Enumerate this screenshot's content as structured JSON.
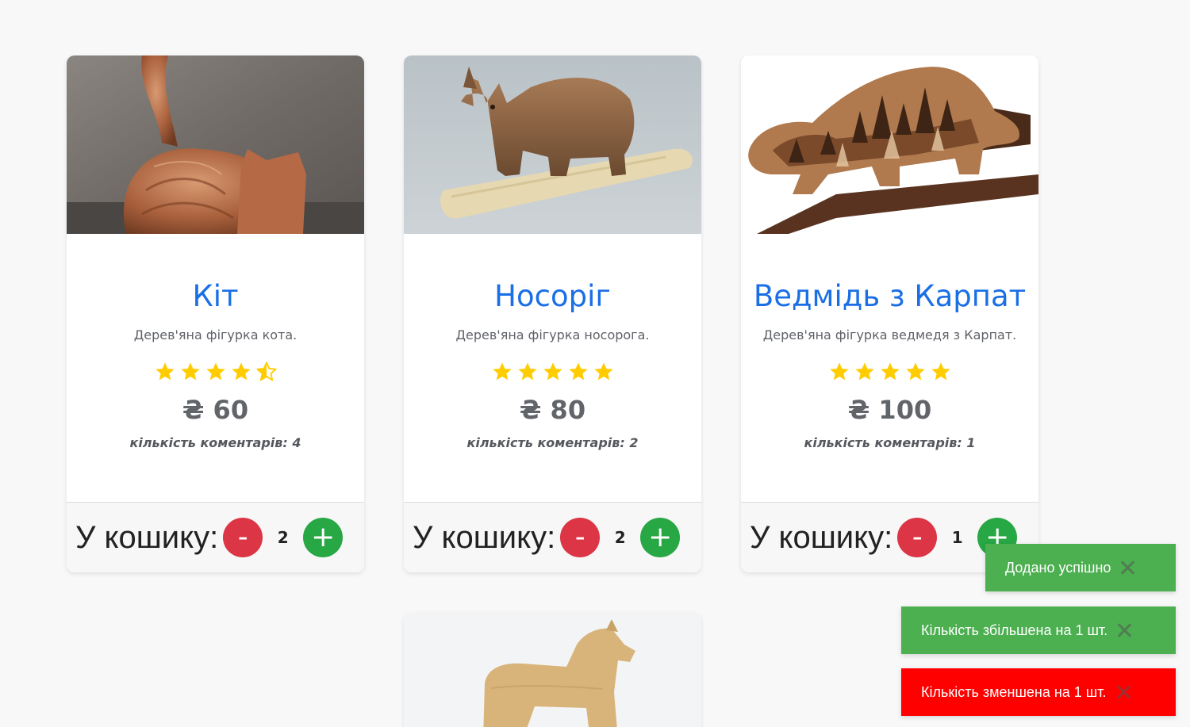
{
  "products": [
    {
      "title": "Кіт",
      "description": "Дерев'яна фігурка кота.",
      "rating": 4.5,
      "price": "₴ 60",
      "comments": "кількість коментарів: 4",
      "cart_label": "У кошику:",
      "minus_label": "-",
      "plus_label": "+",
      "quantity": "2",
      "image": "wooden-cat-figurine"
    },
    {
      "title": "Носоріг",
      "description": "Дерев'яна фігурка носорога.",
      "rating": 5,
      "price": "₴ 80",
      "comments": "кількість коментарів: 2",
      "cart_label": "У кошику:",
      "minus_label": "-",
      "plus_label": "+",
      "quantity": "2",
      "image": "wooden-rhino-figurine"
    },
    {
      "title": "Ведмідь з Карпат",
      "description": "Дерев'яна фігурка ведмедя з Карпат.",
      "rating": 5,
      "price": "₴ 100",
      "comments": "кількість коментарів: 1",
      "cart_label": "У кошику:",
      "minus_label": "-",
      "plus_label": "+",
      "quantity": "1",
      "image": "carpathian-bear-figurine"
    },
    {
      "image": "wooden-horse-figurine"
    }
  ],
  "toasts": [
    {
      "text": "Додано успішно",
      "color": "#4caf50"
    },
    {
      "text": "Кількість збільшена на 1 шт.",
      "color": "#4caf50"
    },
    {
      "text": "Кількість зменшена на 1 шт.",
      "color": "#ff0000"
    }
  ],
  "colors": {
    "accent": "#1a6fe6",
    "star": "#ffcc00",
    "minus": "#dc3545",
    "plus": "#28a745"
  }
}
